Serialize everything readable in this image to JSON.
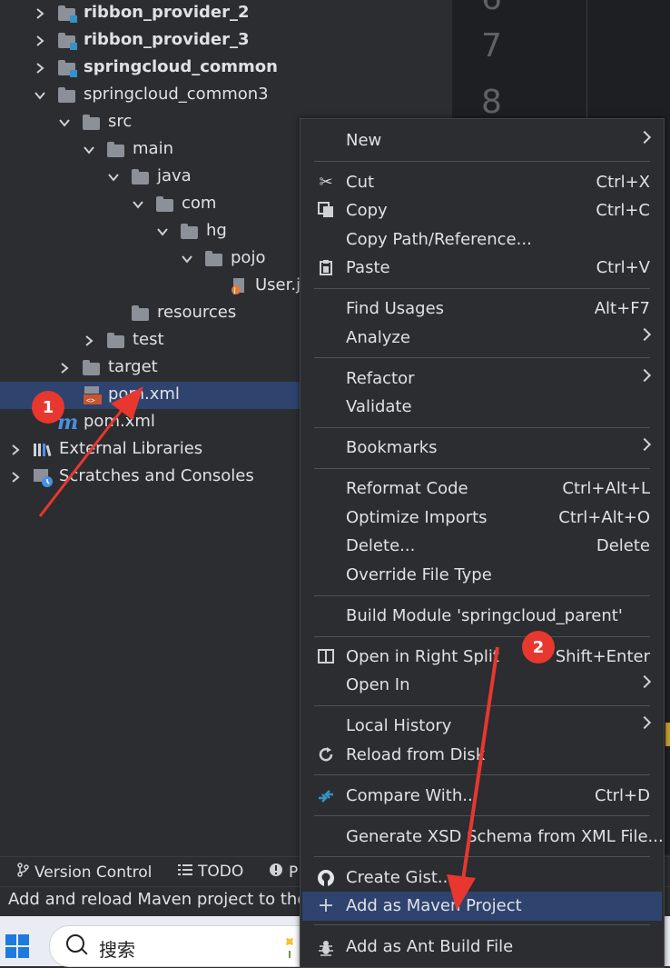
{
  "project_tree": [
    {
      "label": "ribbon_provider_2",
      "bold": true,
      "icon": "module-folder-icon"
    },
    {
      "label": "ribbon_provider_3",
      "bold": true,
      "icon": "module-folder-icon"
    },
    {
      "label": "springcloud_common",
      "bold": true,
      "icon": "module-folder-icon"
    },
    {
      "label": "springcloud_common3",
      "bold": false,
      "icon": "folder-icon"
    },
    {
      "label": "src",
      "icon": "folder-icon"
    },
    {
      "label": "main",
      "icon": "folder-icon"
    },
    {
      "label": "java",
      "icon": "folder-icon"
    },
    {
      "label": "com",
      "icon": "folder-icon"
    },
    {
      "label": "hg",
      "icon": "folder-icon"
    },
    {
      "label": "pojo",
      "icon": "folder-icon"
    },
    {
      "label": "User.ja",
      "icon": "java-file-icon"
    },
    {
      "label": "resources",
      "icon": "folder-icon"
    },
    {
      "label": "test",
      "icon": "folder-icon"
    },
    {
      "label": "target",
      "icon": "folder-icon"
    },
    {
      "label": "pom.xml",
      "icon": "xml-file-icon",
      "selected": true
    },
    {
      "label": "pom.xml",
      "icon": "maven-icon"
    },
    {
      "label": "External Libraries",
      "icon": "libraries-icon"
    },
    {
      "label": "Scratches and Consoles",
      "icon": "scratches-icon"
    }
  ],
  "gutter_lines": [
    "7",
    "8"
  ],
  "bottom_tools": [
    {
      "label": "Version Control",
      "icon": "branch-icon"
    },
    {
      "label": "TODO",
      "icon": "list-icon"
    },
    {
      "label": "P",
      "icon": "problems-icon"
    }
  ],
  "status_text": "Add and reload Maven project to the",
  "taskbar": {
    "search_placeholder": "搜索"
  },
  "context_menu": [
    {
      "label": "New",
      "submenu": true
    },
    {
      "label": "Cut",
      "shortcut": "Ctrl+X",
      "icon": "scissors-icon"
    },
    {
      "label": "Copy",
      "shortcut": "Ctrl+C",
      "icon": "copy-icon"
    },
    {
      "label": "Copy Path/Reference..."
    },
    {
      "label": "Paste",
      "shortcut": "Ctrl+V",
      "icon": "paste-icon"
    },
    {
      "label": "Find Usages",
      "shortcut": "Alt+F7"
    },
    {
      "label": "Analyze",
      "submenu": true
    },
    {
      "label": "Refactor",
      "submenu": true
    },
    {
      "label": "Validate"
    },
    {
      "label": "Bookmarks",
      "submenu": true
    },
    {
      "label": "Reformat Code",
      "shortcut": "Ctrl+Alt+L"
    },
    {
      "label": "Optimize Imports",
      "shortcut": "Ctrl+Alt+O"
    },
    {
      "label": "Delete...",
      "shortcut": "Delete"
    },
    {
      "label": "Override File Type"
    },
    {
      "label": "Build Module 'springcloud_parent'"
    },
    {
      "label": "Open in Right Split",
      "shortcut": "Shift+Enter",
      "icon": "split-icon"
    },
    {
      "label": "Open In",
      "submenu": true
    },
    {
      "label": "Local History",
      "submenu": true
    },
    {
      "label": "Reload from Disk",
      "icon": "reload-icon"
    },
    {
      "label": "Compare With...",
      "shortcut": "Ctrl+D",
      "icon": "compare-icon"
    },
    {
      "label": "Generate XSD Schema from XML File..."
    },
    {
      "label": "Create Gist...",
      "icon": "github-icon"
    },
    {
      "label": "Add as Maven Project",
      "icon": "plus-icon",
      "highlighted": true
    },
    {
      "label": "Add as Ant Build File",
      "icon": "ant-icon"
    }
  ],
  "annotations": [
    "1",
    "2"
  ],
  "colors": {
    "accent_selection": "#2e436e",
    "annotation_red": "#e8372f",
    "panel_bg": "#2b2d30",
    "editor_bg": "#1e1f22"
  }
}
